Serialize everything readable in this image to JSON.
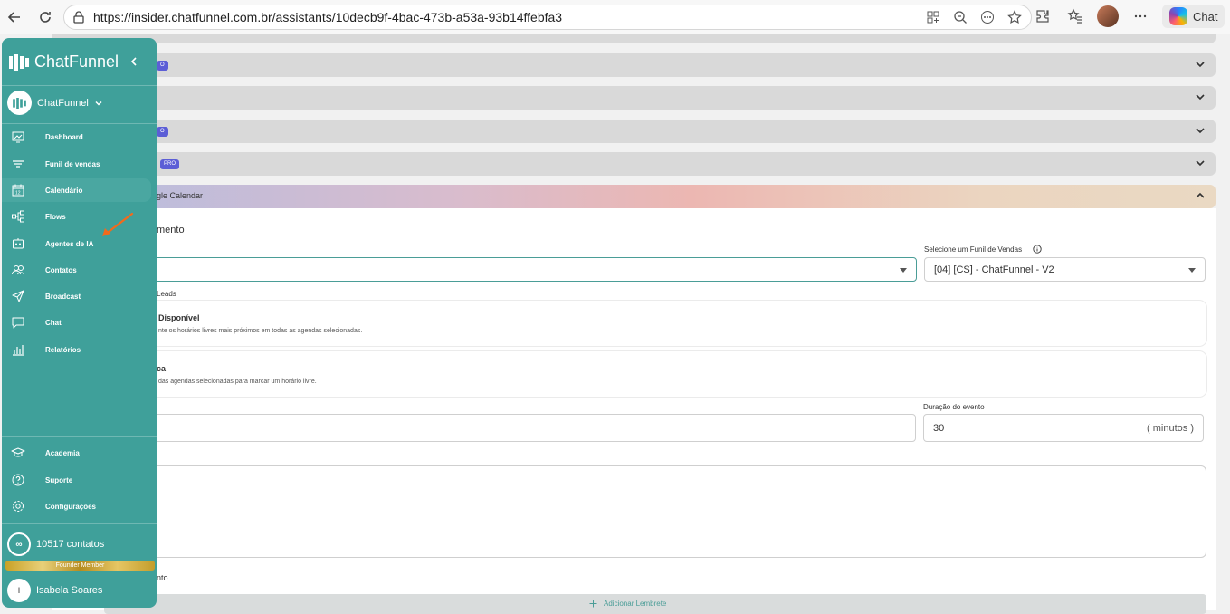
{
  "browser": {
    "url": "https://insider.chatfunnel.com.br/assistants/10decb9f-4bac-473b-a53a-93b14ffebfa3",
    "chat_label": "Chat"
  },
  "sidebar": {
    "brand": "ChatFunnel",
    "account": "ChatFunnel",
    "items": [
      {
        "label": "Dashboard",
        "icon": "dashboard-icon"
      },
      {
        "label": "Funil de vendas",
        "icon": "funnel-icon"
      },
      {
        "label": "Calendário",
        "icon": "calendar-icon"
      },
      {
        "label": "Flows",
        "icon": "flows-icon"
      },
      {
        "label": "Agentes de IA",
        "icon": "robot-icon"
      },
      {
        "label": "Contatos",
        "icon": "contacts-icon"
      },
      {
        "label": "Broadcast",
        "icon": "send-icon"
      },
      {
        "label": "Chat",
        "icon": "chat-icon"
      },
      {
        "label": "Relatórios",
        "icon": "reports-icon"
      }
    ],
    "bottom_items": [
      {
        "label": "Academia",
        "icon": "academy-icon"
      },
      {
        "label": "Suporte",
        "icon": "help-icon"
      },
      {
        "label": "Configurações",
        "icon": "settings-icon"
      }
    ],
    "contacts": "10517 contatos",
    "contacts_symbol": "∞",
    "founder": "Founder Member",
    "user_initial": "I",
    "user_name": "Isabela Soares"
  },
  "main": {
    "badges": [
      "O",
      "O",
      "PRO"
    ],
    "calendar_bar": "gle Calendar",
    "section_heading": "mento",
    "funnel_label": "Selecione um Funil de Vendas",
    "funnel_value": "[04] [CS] - ChatFunnel - V2",
    "leads_label": "Leads",
    "option1_title": "Disponível",
    "option1_desc": "nte os horários livres mais próximos em todas as agendas selecionadas.",
    "option2_title": "ca",
    "option2_desc": "das agendas selecionadas para marcar um horário livre.",
    "duration_label": "Duração do evento",
    "duration_value": "30",
    "duration_unit": "( minutos )",
    "reminder_heading": "nto",
    "add_reminder": "Adicionar Lembrete"
  }
}
